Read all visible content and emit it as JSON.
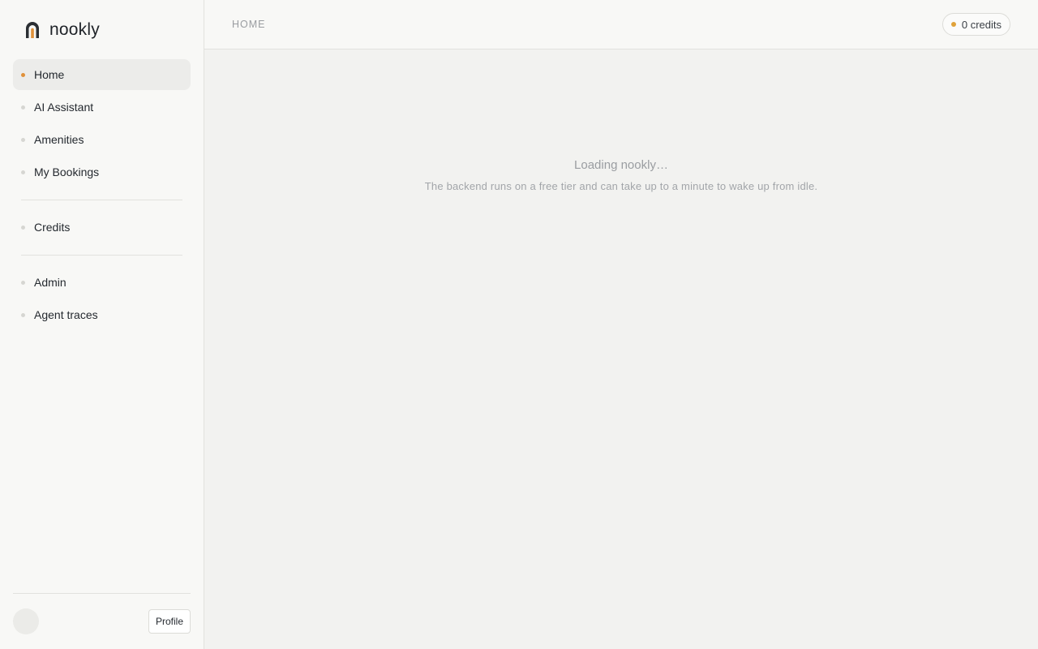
{
  "app": {
    "name": "nookly",
    "accent": "#e0913a"
  },
  "sidebar": {
    "logo_icon": "arch-logo-icon",
    "groups": [
      [
        {
          "label": "Home",
          "active": true
        },
        {
          "label": "AI Assistant"
        },
        {
          "label": "Amenities"
        },
        {
          "label": "My Bookings"
        }
      ],
      [
        {
          "label": "Credits"
        }
      ],
      [
        {
          "label": "Admin"
        },
        {
          "label": "Agent traces"
        }
      ]
    ],
    "footer": {
      "profile_label": "Profile"
    }
  },
  "header": {
    "breadcrumb": "HOME",
    "credits_label": "0 credits"
  },
  "main": {
    "loading_title": "Loading nookly…",
    "loading_subtitle": "The backend runs on a free tier and can take up to a minute to wake up from idle."
  }
}
